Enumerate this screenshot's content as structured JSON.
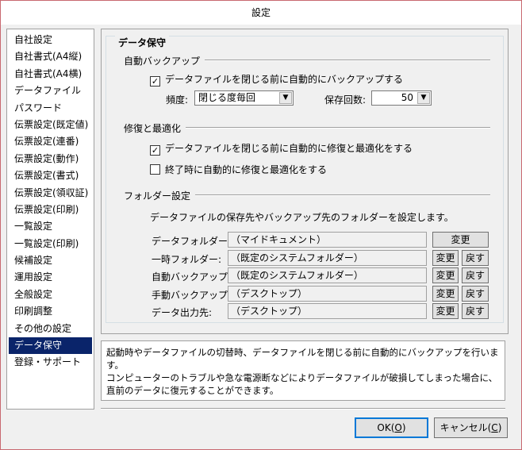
{
  "window": {
    "title": "設定"
  },
  "sidebar": {
    "items": [
      {
        "label": "自社設定"
      },
      {
        "label": "自社書式(A4縦)"
      },
      {
        "label": "自社書式(A4横)"
      },
      {
        "label": "データファイル"
      },
      {
        "label": "パスワード"
      },
      {
        "label": "伝票設定(既定値)"
      },
      {
        "label": "伝票設定(連番)"
      },
      {
        "label": "伝票設定(動作)"
      },
      {
        "label": "伝票設定(書式)"
      },
      {
        "label": "伝票設定(領収証)"
      },
      {
        "label": "伝票設定(印刷)"
      },
      {
        "label": "一覧設定"
      },
      {
        "label": "一覧設定(印刷)"
      },
      {
        "label": "候補設定"
      },
      {
        "label": "運用設定"
      },
      {
        "label": "全般設定"
      },
      {
        "label": "印刷調整"
      },
      {
        "label": "その他の設定"
      },
      {
        "label": "データ保守",
        "active": true
      },
      {
        "label": "登録・サポート"
      }
    ]
  },
  "group": {
    "title": "データ保守"
  },
  "auto_backup": {
    "title": "自動バックアップ",
    "checkbox_label": "データファイルを閉じる前に自動的にバックアップする",
    "checked": true,
    "check_mark": "✓",
    "frequency_label": "頻度:",
    "frequency_value": "閉じる度毎回",
    "count_label": "保存回数:",
    "count_value": "50"
  },
  "repair": {
    "title": "修復と最適化",
    "opt1_label": "データファイルを閉じる前に自動的に修復と最適化をする",
    "opt1_checked": true,
    "opt2_label": "終了時に自動的に修復と最適化をする",
    "opt2_checked": false
  },
  "folders": {
    "title": "フォルダー設定",
    "description": "データファイルの保存先やバックアップ先のフォルダーを設定します。",
    "change_label": "変更",
    "reset_label": "戻す",
    "rows": [
      {
        "label": "データフォルダー:",
        "value": "（マイドキュメント）"
      },
      {
        "label": "一時フォルダー:",
        "value": "（既定のシステムフォルダー）"
      },
      {
        "label": "自動バックアップ:",
        "value": "（既定のシステムフォルダー）"
      },
      {
        "label": "手動バックアップ:",
        "value": "（デスクトップ）"
      },
      {
        "label": "データ出力先:",
        "value": "（デスクトップ）"
      }
    ]
  },
  "info": {
    "text1": "起動時やデータファイルの切替時、データファイルを閉じる前に自動的にバックアップを行います。",
    "text2": "コンピューターのトラブルや急な電源断などによりデータファイルが破損してしまった場合に、直前のデータに復元することができます。"
  },
  "footer": {
    "ok_label": "OK(",
    "ok_key": "O",
    "ok_end": ")",
    "cancel_label": "キャンセル(",
    "cancel_key": "C",
    "cancel_end": ")"
  }
}
